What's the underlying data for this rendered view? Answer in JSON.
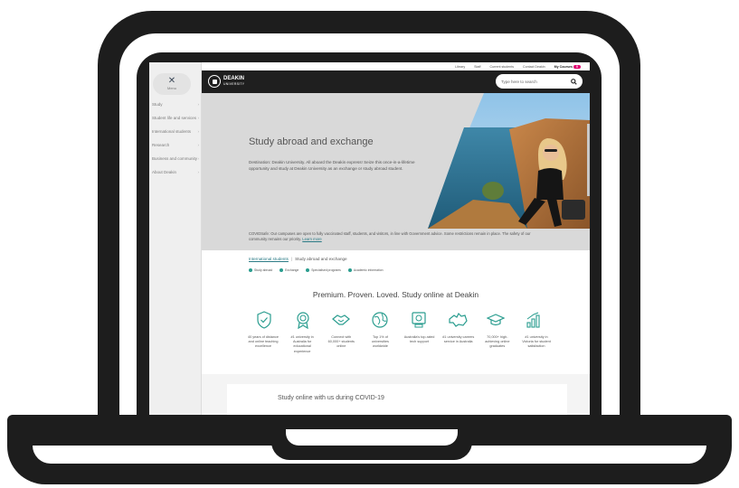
{
  "sidebar": {
    "menu_label": "Menu",
    "items": [
      {
        "label": "Study"
      },
      {
        "label": "Student life and services"
      },
      {
        "label": "International students"
      },
      {
        "label": "Research"
      },
      {
        "label": "Business and community"
      },
      {
        "label": "About Deakin"
      }
    ]
  },
  "util_bar": {
    "links": [
      "Library",
      "Staff",
      "Current students",
      "Contact Deakin"
    ],
    "my_courses": "My Courses",
    "courses_count": "0"
  },
  "header": {
    "logo_name": "DEAKIN",
    "logo_sub": "UNIVERSITY",
    "search_placeholder": "Type here to search"
  },
  "hero": {
    "title": "Study abroad and exchange",
    "description": "Destination: Deakin University. All aboard the Deakin express! Seize this once-in-a-lifetime opportunity and study at Deakin University as an exchange or study abroad student."
  },
  "covid_notice": {
    "text": "COVIDSafe: Our campuses are open to fully vaccinated staff, students, and visitors, in line with Government advice. Some restrictions remain in place. The safety of our community remains our priority.",
    "link": "Learn more"
  },
  "breadcrumb": {
    "link": "International students",
    "current": "Study abroad and exchange"
  },
  "pills": [
    "Study abroad",
    "Exchange",
    "Specialised programs",
    "Academic information"
  ],
  "premium": {
    "heading": "Premium. Proven. Loved. Study online at Deakin",
    "features": [
      {
        "icon": "shield-check-icon",
        "text": "40 years of distance and online teaching excellence"
      },
      {
        "icon": "award-medal-icon",
        "text": "#1 university in Australia for educational experience"
      },
      {
        "icon": "handshake-icon",
        "text": "Connect with 60,000+ students online"
      },
      {
        "icon": "globe-icon",
        "text": "Top 1% of universities worldwide"
      },
      {
        "icon": "tech-support-icon",
        "text": "Australia's top-rated tech support"
      },
      {
        "icon": "australia-map-icon",
        "text": "#1 university careers service in Australia"
      },
      {
        "icon": "graduation-cap-icon",
        "text": "70,000+ high-achieving online graduates"
      },
      {
        "icon": "bar-chart-icon",
        "text": "#1 university in Victoria for student satisfaction"
      }
    ]
  },
  "study_online": {
    "heading": "Study online with us during COVID-19"
  },
  "colors": {
    "laptop": "#1d1d1d",
    "accent_teal": "#2a9d8f",
    "badge_pink": "#e0006f",
    "header_bg": "#1f1f1f"
  }
}
